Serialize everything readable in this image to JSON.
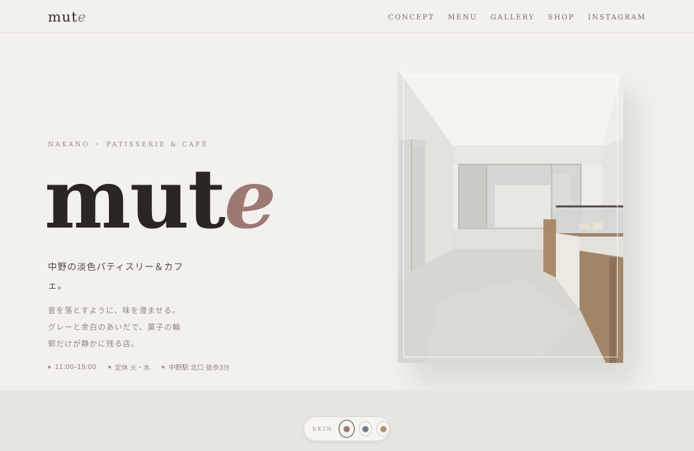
{
  "header": {
    "logo_main": "mut",
    "logo_accent": "e",
    "nav": [
      "CONCEPT",
      "MENU",
      "GALLERY",
      "SHOP",
      "INSTAGRAM"
    ]
  },
  "hero": {
    "eyebrow": "NAKANO ・ PATISSERIE & CAFÉ",
    "title_main": "mut",
    "title_accent": "e",
    "subtitle": "中野の淡色パティスリー＆カフェ。",
    "description": "音を落とすように、味を澄ませる。グレーと余白のあいだで、菓子の輪郭だけが静かに残る店。",
    "info": [
      "11:00–19:00",
      "定休 火・水",
      "中野駅 北口 徒歩3分"
    ]
  },
  "skin": {
    "label": "SKIN",
    "swatches": [
      {
        "color": "#9c7a73",
        "active": true
      },
      {
        "color": "#6f7d8c",
        "active": false
      },
      {
        "color": "#b09076",
        "active": false
      }
    ]
  },
  "colors": {
    "background": "#f3f1ee",
    "accent": "#9c7a73",
    "text": "#2a2624"
  }
}
